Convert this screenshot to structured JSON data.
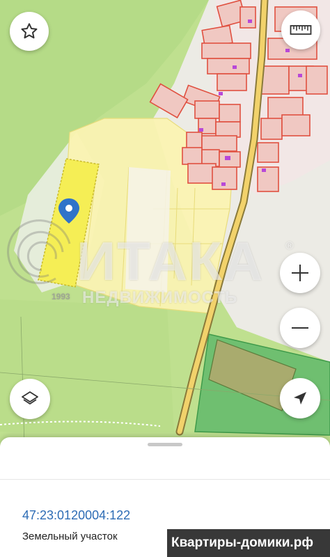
{
  "map": {
    "watermark": {
      "brand": "ИТАКА",
      "registered": "®",
      "subtitle": "НЕДВИЖИМОСТЬ",
      "year": "1993"
    }
  },
  "controls": {
    "favorite_icon": "star-icon",
    "ruler_icon": "ruler-icon",
    "zoom_in_icon": "plus-icon",
    "zoom_out_icon": "minus-icon",
    "layers_icon": "layers-icon",
    "locate_icon": "navigation-arrow-icon"
  },
  "parcel": {
    "cadastral_number": "47:23:0120004:122",
    "type": "Земельный участок"
  },
  "footer": {
    "site": "Квартиры-домики.рф"
  },
  "colors": {
    "terrain": "#bfe08f",
    "selected_parcel": "#f5ee55",
    "parcel_border": "#e05040",
    "road": "#f2d26b",
    "link": "#2d6cb5",
    "marker": "#2f73c9"
  }
}
